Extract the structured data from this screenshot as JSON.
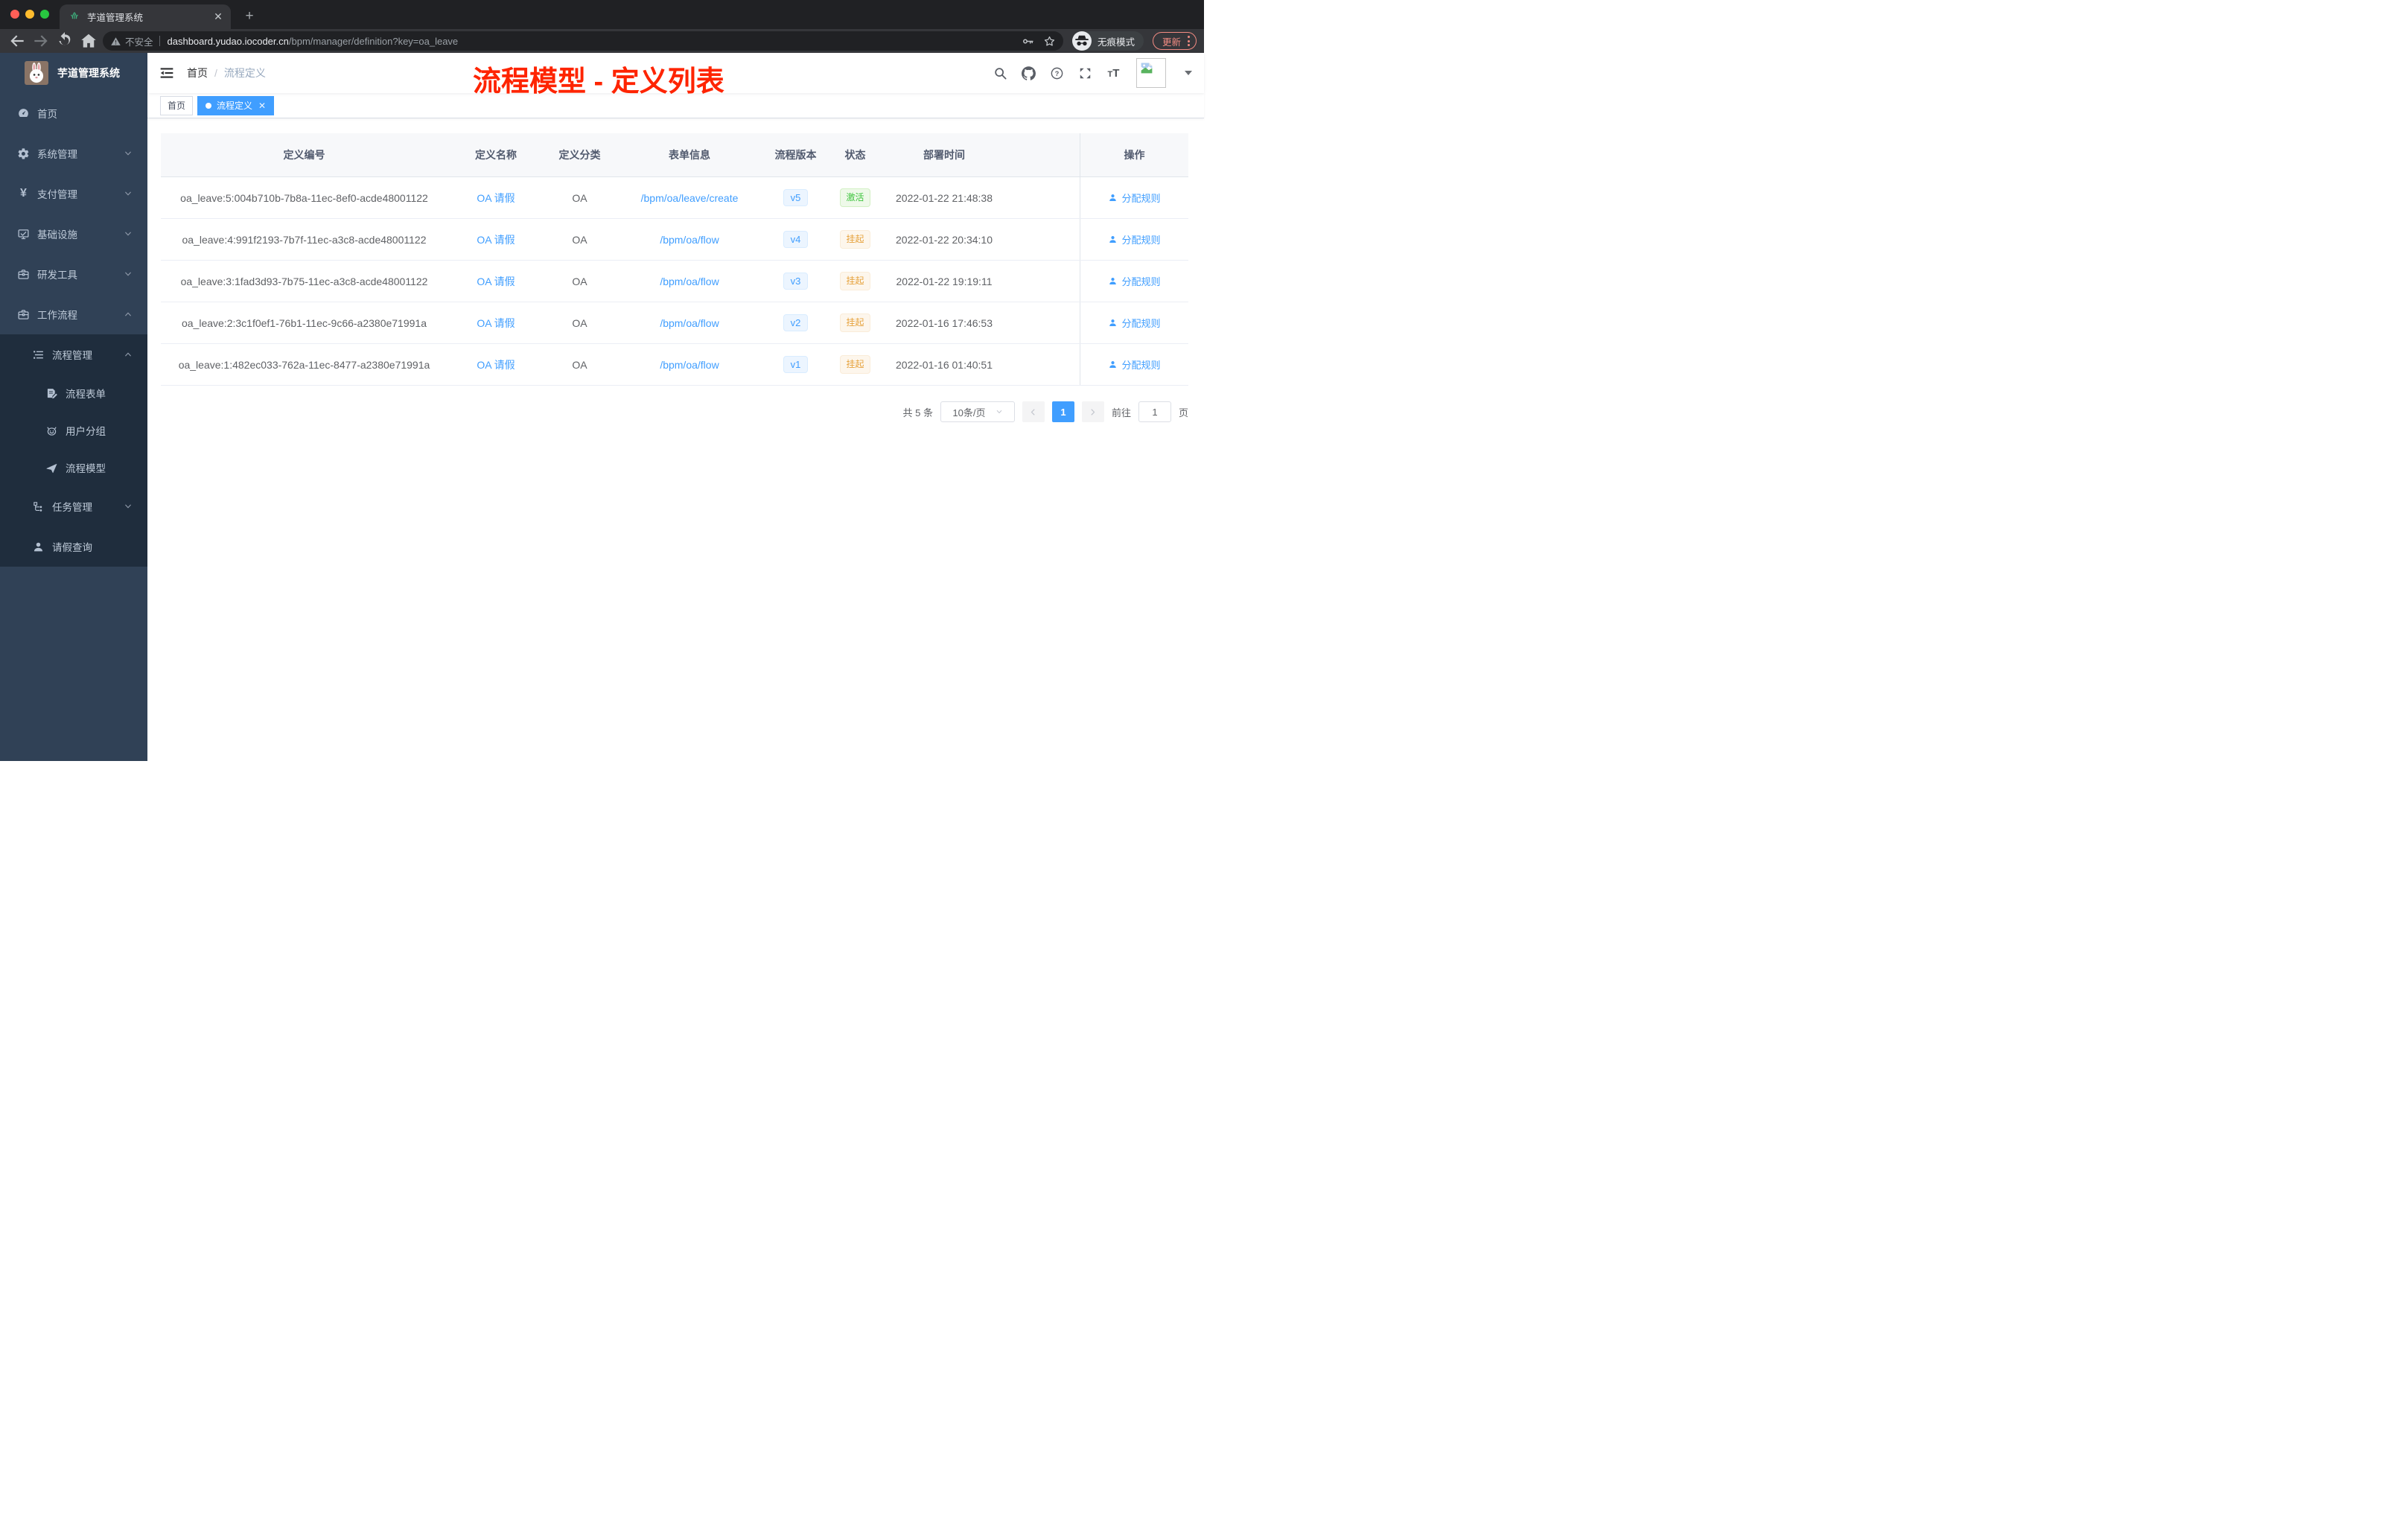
{
  "colors": {
    "accent": "#409eff",
    "annotation_red": "#fe2400",
    "sidebar_bg": "#304156",
    "sidebar_submenu_bg": "#1f2d3d",
    "success_text": "#3ec43e",
    "warning_text": "#e6a23c",
    "traffic_lights": [
      "#ff5f57",
      "#febc2e",
      "#28c840"
    ]
  },
  "browser": {
    "tab_title": "芋道管理系统",
    "security_label": "不安全",
    "url_host": "dashboard.yudao.iocoder.cn",
    "url_path": "/bpm/manager/definition?key=oa_leave",
    "incognito_label": "无痕模式",
    "update_label": "更新"
  },
  "sidebar": {
    "title": "芋道管理系统",
    "items": [
      {
        "label": "首页",
        "icon": "dashboard-icon",
        "level": 1,
        "dark": false,
        "arrow": null
      },
      {
        "label": "系统管理",
        "icon": "gear-icon",
        "level": 1,
        "dark": false,
        "arrow": "down"
      },
      {
        "label": "支付管理",
        "icon": "yen-icon",
        "level": 1,
        "dark": false,
        "arrow": "down"
      },
      {
        "label": "基础设施",
        "icon": "monitor-icon",
        "level": 1,
        "dark": false,
        "arrow": "down"
      },
      {
        "label": "研发工具",
        "icon": "toolbox-icon",
        "level": 1,
        "dark": false,
        "arrow": "down"
      },
      {
        "label": "工作流程",
        "icon": "toolbox-icon",
        "level": 1,
        "dark": false,
        "arrow": "up"
      },
      {
        "label": "流程管理",
        "icon": "list-icon",
        "level": 2,
        "dark": true,
        "arrow": "up"
      },
      {
        "label": "流程表单",
        "icon": "form-icon",
        "level": 3,
        "dark": true,
        "arrow": null
      },
      {
        "label": "用户分组",
        "icon": "user-group-icon",
        "level": 3,
        "dark": true,
        "arrow": null
      },
      {
        "label": "流程模型",
        "icon": "paper-plane-icon",
        "level": 3,
        "dark": true,
        "arrow": null
      },
      {
        "label": "任务管理",
        "icon": "tree-icon",
        "level": 2,
        "dark": true,
        "arrow": "down"
      },
      {
        "label": "请假查询",
        "icon": "user-icon",
        "level": 2,
        "dark": true,
        "arrow": null
      }
    ]
  },
  "navbar": {
    "breadcrumb": [
      "首页",
      "流程定义"
    ],
    "icons": [
      "search-icon",
      "github-icon",
      "question-icon",
      "fullscreen-icon",
      "font-size-icon"
    ],
    "annotation": "流程模型 - 定义列表"
  },
  "tags": [
    {
      "label": "首页",
      "active": false,
      "closable": false
    },
    {
      "label": "流程定义",
      "active": true,
      "closable": true
    }
  ],
  "table": {
    "columns": [
      "定义编号",
      "定义名称",
      "定义分类",
      "表单信息",
      "流程版本",
      "状态",
      "部署时间",
      "操作"
    ],
    "action_label": "分配规则",
    "rows": [
      {
        "id": "oa_leave:5:004b710b-7b8a-11ec-8ef0-acde48001122",
        "name": "OA 请假",
        "category": "OA",
        "form": "/bpm/oa/leave/create",
        "version": "v5",
        "status": "激活",
        "status_type": "success",
        "time": "2022-01-22 21:48:38"
      },
      {
        "id": "oa_leave:4:991f2193-7b7f-11ec-a3c8-acde48001122",
        "name": "OA 请假",
        "category": "OA",
        "form": "/bpm/oa/flow",
        "version": "v4",
        "status": "挂起",
        "status_type": "warning",
        "time": "2022-01-22 20:34:10"
      },
      {
        "id": "oa_leave:3:1fad3d93-7b75-11ec-a3c8-acde48001122",
        "name": "OA 请假",
        "category": "OA",
        "form": "/bpm/oa/flow",
        "version": "v3",
        "status": "挂起",
        "status_type": "warning",
        "time": "2022-01-22 19:19:11"
      },
      {
        "id": "oa_leave:2:3c1f0ef1-76b1-11ec-9c66-a2380e71991a",
        "name": "OA 请假",
        "category": "OA",
        "form": "/bpm/oa/flow",
        "version": "v2",
        "status": "挂起",
        "status_type": "warning",
        "time": "2022-01-16 17:46:53"
      },
      {
        "id": "oa_leave:1:482ec033-762a-11ec-8477-a2380e71991a",
        "name": "OA 请假",
        "category": "OA",
        "form": "/bpm/oa/flow",
        "version": "v1",
        "status": "挂起",
        "status_type": "warning",
        "time": "2022-01-16 01:40:51"
      }
    ]
  },
  "pagination": {
    "total_label": "共 5 条",
    "page_size_label": "10条/页",
    "current_page": "1",
    "goto_label": "前往",
    "goto_value": "1",
    "unit_label": "页"
  }
}
